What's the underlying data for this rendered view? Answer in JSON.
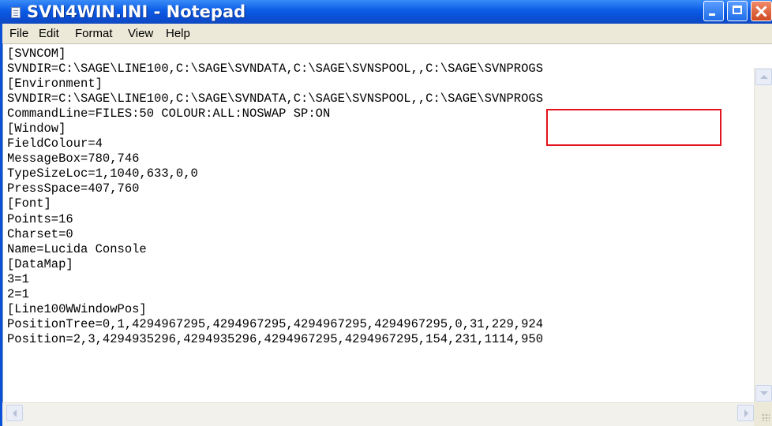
{
  "window": {
    "title": "SVN4WIN.INI - Notepad",
    "titlebar_color": "#0a51d8",
    "controls": {
      "minimize_icon": "minimize-icon",
      "maximize_icon": "maximize-icon",
      "close_icon": "close-icon",
      "close_color": "#e0552b"
    }
  },
  "menu": [
    "File",
    "Edit",
    "Format",
    "View",
    "Help"
  ],
  "editor": {
    "lines": [
      "[SVNCOM]",
      "SVNDIR=C:\\SAGE\\LINE100,C:\\SAGE\\SVNDATA,C:\\SAGE\\SVNSPOOL,,C:\\SAGE\\SVNPROGS",
      "[Environment]",
      "SVNDIR=C:\\SAGE\\LINE100,C:\\SAGE\\SVNDATA,C:\\SAGE\\SVNSPOOL,,C:\\SAGE\\SVNPROGS",
      "CommandLine=FILES:50 COLOUR:ALL:NOSWAP SP:ON",
      "[Window]",
      "FieldColour=4",
      "MessageBox=780,746",
      "TypeSizeLoc=1,1040,633,0,0",
      "PressSpace=407,760",
      "[Font]",
      "Points=16",
      "Charset=0",
      "Name=Lucida Console",
      "[DataMap]",
      "3=1",
      "2=1",
      "[Line100WWindowPos]",
      "PositionTree=0,1,4294967295,4294967295,4294967295,4294967295,0,31,229,924",
      "Position=2,3,4294935296,4294935296,4294967295,4294967295,154,231,1114,950"
    ],
    "highlight": {
      "text": "C:\\SAGE\\SVNPROGS",
      "color": "#e4121b"
    }
  },
  "scrollbars": {
    "up_icon": "scroll-up-arrow-icon",
    "down_icon": "scroll-down-arrow-icon",
    "left_icon": "scroll-left-arrow-icon",
    "right_icon": "scroll-right-arrow-icon"
  }
}
